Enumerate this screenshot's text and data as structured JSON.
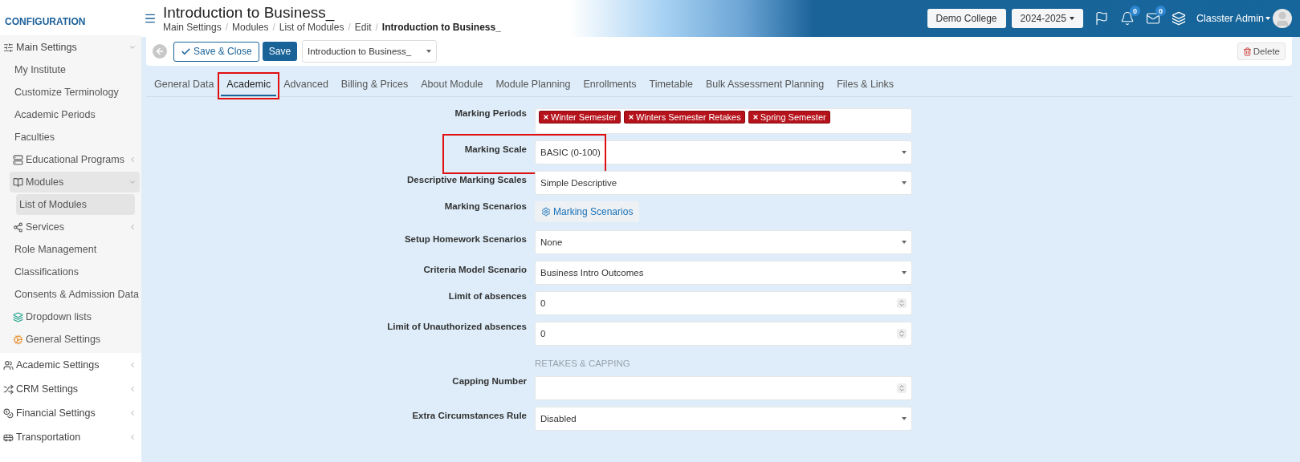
{
  "sidebar": {
    "heading": "CONFIGURATION",
    "items": [
      {
        "label": "Main Settings",
        "expanded": true,
        "children": [
          {
            "label": "My Institute"
          },
          {
            "label": "Customize Terminology"
          },
          {
            "label": "Academic Periods"
          },
          {
            "label": "Faculties"
          },
          {
            "label": "Educational Programs",
            "expanded": false
          },
          {
            "label": "Modules",
            "expanded": true,
            "children": [
              {
                "label": "List of Modules",
                "selected": true
              }
            ]
          },
          {
            "label": "Services",
            "expanded": false
          },
          {
            "label": "Role Management"
          },
          {
            "label": "Classifications"
          },
          {
            "label": "Consents & Admission Data"
          },
          {
            "label": "Dropdown lists"
          },
          {
            "label": "General Settings"
          }
        ]
      },
      {
        "label": "Academic Settings",
        "expanded": false
      },
      {
        "label": "CRM Settings",
        "expanded": false
      },
      {
        "label": "Financial Settings",
        "expanded": false
      },
      {
        "label": "Transportation",
        "expanded": false
      }
    ]
  },
  "header": {
    "title": "Introduction to Business_",
    "breadcrumb_separator": "/",
    "breadcrumbs": [
      "Main Settings",
      "Modules",
      "List of Modules",
      "Edit",
      "Introduction to Business_"
    ],
    "institution": "Demo College",
    "year": "2024-2025",
    "notifications": "0",
    "messages": "0",
    "user": "Classter Admin"
  },
  "toolbar": {
    "save_close": "Save & Close",
    "save": "Save",
    "record": "Introduction to Business_",
    "delete": "Delete"
  },
  "tabs": [
    {
      "label": "General Data",
      "selected": false,
      "highlighted": false
    },
    {
      "label": "Academic",
      "selected": true,
      "highlighted": true
    },
    {
      "label": "Advanced",
      "selected": false,
      "highlighted": false
    },
    {
      "label": "Billing & Prices",
      "selected": false,
      "highlighted": false
    },
    {
      "label": "About Module",
      "selected": false,
      "highlighted": false
    },
    {
      "label": "Module Planning",
      "selected": false,
      "highlighted": false
    },
    {
      "label": "Enrollments",
      "selected": false,
      "highlighted": false
    },
    {
      "label": "Timetable",
      "selected": false,
      "highlighted": false
    },
    {
      "label": "Bulk Assessment Planning",
      "selected": false,
      "highlighted": false
    },
    {
      "label": "Files & Links",
      "selected": false,
      "highlighted": false
    }
  ],
  "fields": [
    {
      "kind": "tags",
      "label": "Marking Periods",
      "tags": [
        "Winter Semester",
        "Winters Semester Retakes",
        "Spring Semester"
      ]
    },
    {
      "kind": "select",
      "label": "Marking Scale",
      "value": "BASIC (0-100)",
      "highlighted": true
    },
    {
      "kind": "select",
      "label": "Descriptive Marking Scales",
      "value": "Simple Descriptive"
    },
    {
      "kind": "button",
      "label": "Marking Scenarios",
      "value": "Marking Scenarios"
    },
    {
      "kind": "select",
      "label": "Setup Homework Scenarios",
      "value": "None"
    },
    {
      "kind": "select",
      "label": "Criteria Model Scenario",
      "value": "Business Intro Outcomes"
    },
    {
      "kind": "number",
      "label": "Limit of absences",
      "value": "0"
    },
    {
      "kind": "number",
      "label": "Limit of Unauthorized absences",
      "value": "0"
    },
    {
      "kind": "section",
      "label": "RETAKES & CAPPING"
    },
    {
      "kind": "number",
      "label": "Capping Number"
    },
    {
      "kind": "select",
      "label": "Extra Circumstances Rule",
      "value": "Disabled"
    }
  ]
}
